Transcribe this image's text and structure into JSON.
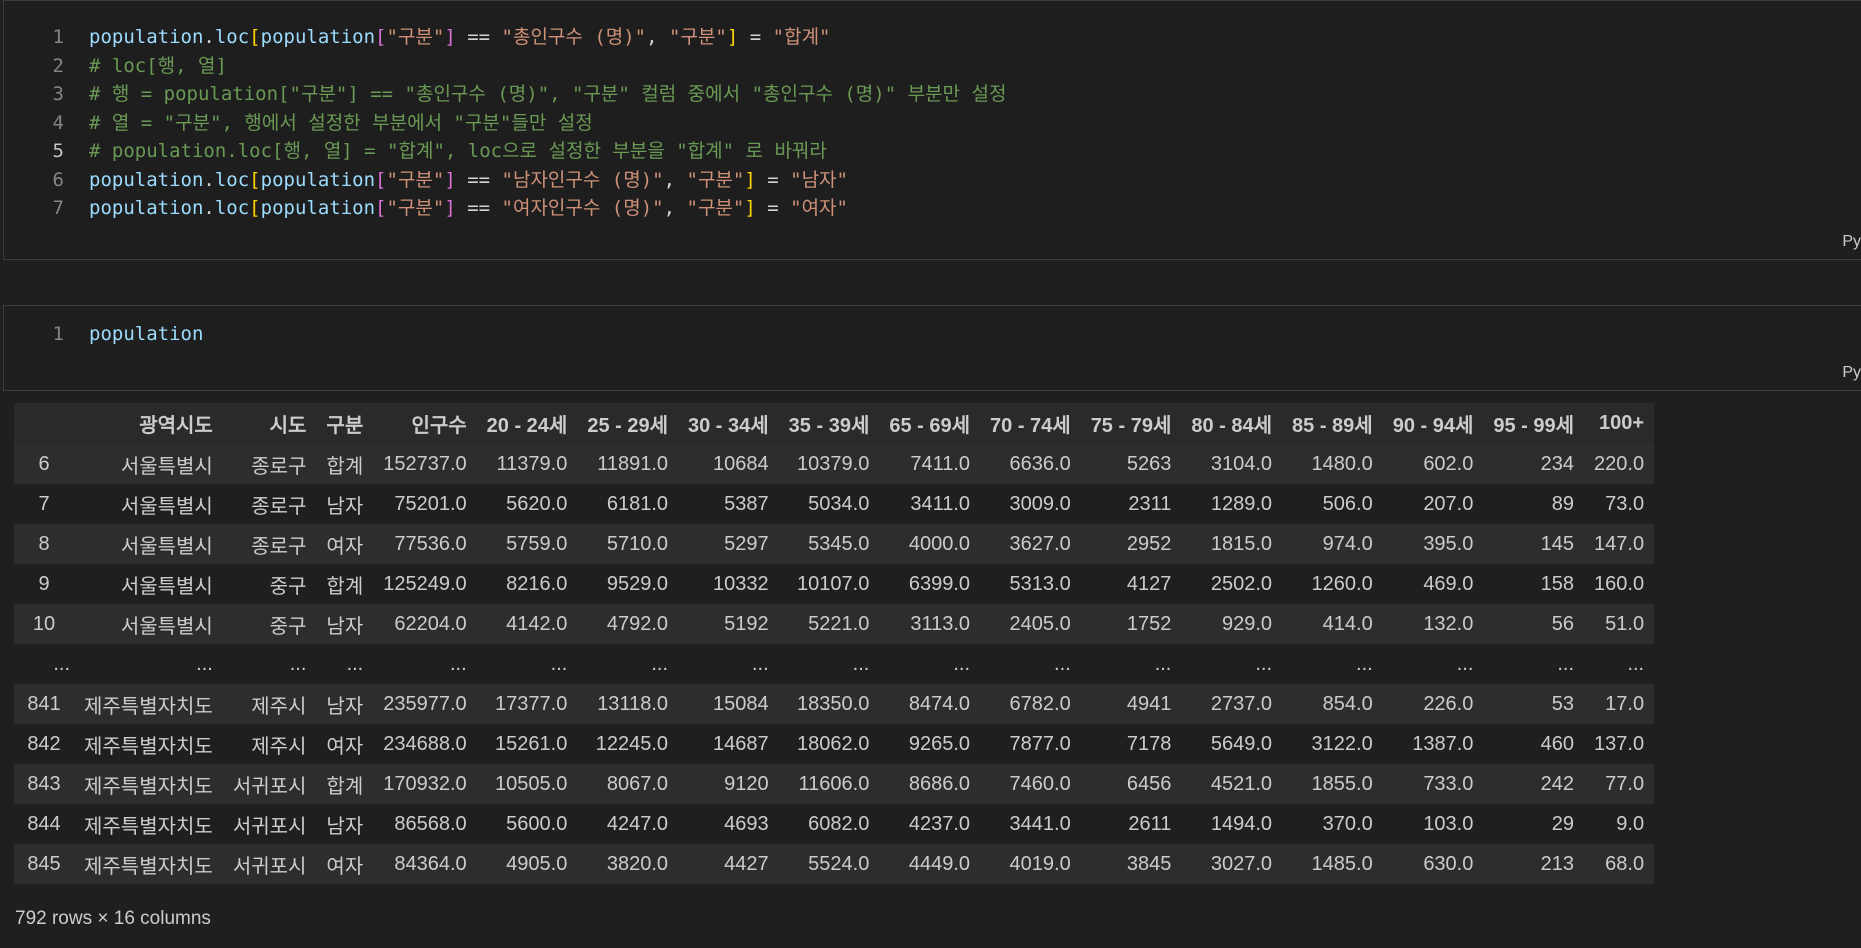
{
  "cell1": {
    "language": "Py",
    "lines": [
      {
        "n": "1",
        "parts": [
          [
            "var",
            "population"
          ],
          [
            "op",
            "."
          ],
          [
            "var",
            "loc"
          ],
          [
            "b1",
            "["
          ],
          [
            "var",
            "population"
          ],
          [
            "b2",
            "["
          ],
          [
            "str",
            "\"구분\""
          ],
          [
            "b2",
            "]"
          ],
          [
            "op",
            " == "
          ],
          [
            "str",
            "\"총인구수 (명)\""
          ],
          [
            "op",
            ", "
          ],
          [
            "str",
            "\"구분\""
          ],
          [
            "b1",
            "]"
          ],
          [
            "op",
            " = "
          ],
          [
            "str",
            "\"합계\""
          ]
        ]
      },
      {
        "n": "2",
        "parts": [
          [
            "cmt",
            "# loc[행, 열]"
          ]
        ]
      },
      {
        "n": "3",
        "parts": [
          [
            "cmt",
            "# 행 = population[\"구분\"] == \"총인구수 (명)\", \"구분\" 컬럼 중에서 \"총인구수 (명)\" 부분만 설정"
          ]
        ]
      },
      {
        "n": "4",
        "parts": [
          [
            "cmt",
            "# 열 = \"구분\", 행에서 설정한 부분에서 \"구분\"들만 설정"
          ]
        ]
      },
      {
        "n": "5",
        "active": true,
        "parts": [
          [
            "cmt",
            "# population.loc[행, 열] = \"합계\", loc으로 설정한 부분을 \"합계\" 로 바꿔라"
          ]
        ]
      },
      {
        "n": "6",
        "parts": [
          [
            "var",
            "population"
          ],
          [
            "op",
            "."
          ],
          [
            "var",
            "loc"
          ],
          [
            "b1",
            "["
          ],
          [
            "var",
            "population"
          ],
          [
            "b2",
            "["
          ],
          [
            "str",
            "\"구분\""
          ],
          [
            "b2",
            "]"
          ],
          [
            "op",
            " == "
          ],
          [
            "str",
            "\"남자인구수 (명)\""
          ],
          [
            "op",
            ", "
          ],
          [
            "str",
            "\"구분\""
          ],
          [
            "b1",
            "]"
          ],
          [
            "op",
            " = "
          ],
          [
            "str",
            "\"남자\""
          ]
        ]
      },
      {
        "n": "7",
        "parts": [
          [
            "var",
            "population"
          ],
          [
            "op",
            "."
          ],
          [
            "var",
            "loc"
          ],
          [
            "b1",
            "["
          ],
          [
            "var",
            "population"
          ],
          [
            "b2",
            "["
          ],
          [
            "str",
            "\"구분\""
          ],
          [
            "b2",
            "]"
          ],
          [
            "op",
            " == "
          ],
          [
            "str",
            "\"여자인구수 (명)\""
          ],
          [
            "op",
            ", "
          ],
          [
            "str",
            "\"구분\""
          ],
          [
            "b1",
            "]"
          ],
          [
            "op",
            " = "
          ],
          [
            "str",
            "\"여자\""
          ]
        ]
      }
    ]
  },
  "cell2": {
    "language": "Py",
    "lines": [
      {
        "n": "1",
        "parts": [
          [
            "var",
            "population"
          ]
        ]
      }
    ]
  },
  "output": {
    "columns": [
      "",
      "광역시도",
      "시도",
      "구분",
      "인구수",
      "20 - 24세",
      "25 - 29세",
      "30 - 34세",
      "35 - 39세",
      "65 - 69세",
      "70 - 74세",
      "75 - 79세",
      "80 - 84세",
      "85 - 89세",
      "90 - 94세",
      "95 - 99세",
      "100+"
    ],
    "rows": [
      [
        "6",
        "서울특별시",
        "종로구",
        "합계",
        "152737.0",
        "11379.0",
        "11891.0",
        "10684",
        "10379.0",
        "7411.0",
        "6636.0",
        "5263",
        "3104.0",
        "1480.0",
        "602.0",
        "234",
        "220.0"
      ],
      [
        "7",
        "서울특별시",
        "종로구",
        "남자",
        "75201.0",
        "5620.0",
        "6181.0",
        "5387",
        "5034.0",
        "3411.0",
        "3009.0",
        "2311",
        "1289.0",
        "506.0",
        "207.0",
        "89",
        "73.0"
      ],
      [
        "8",
        "서울특별시",
        "종로구",
        "여자",
        "77536.0",
        "5759.0",
        "5710.0",
        "5297",
        "5345.0",
        "4000.0",
        "3627.0",
        "2952",
        "1815.0",
        "974.0",
        "395.0",
        "145",
        "147.0"
      ],
      [
        "9",
        "서울특별시",
        "중구",
        "합계",
        "125249.0",
        "8216.0",
        "9529.0",
        "10332",
        "10107.0",
        "6399.0",
        "5313.0",
        "4127",
        "2502.0",
        "1260.0",
        "469.0",
        "158",
        "160.0"
      ],
      [
        "10",
        "서울특별시",
        "중구",
        "남자",
        "62204.0",
        "4142.0",
        "4792.0",
        "5192",
        "5221.0",
        "3113.0",
        "2405.0",
        "1752",
        "929.0",
        "414.0",
        "132.0",
        "56",
        "51.0"
      ],
      [
        "...",
        "...",
        "...",
        "...",
        "...",
        "...",
        "...",
        "...",
        "...",
        "...",
        "...",
        "...",
        "...",
        "...",
        "...",
        "...",
        "..."
      ],
      [
        "841",
        "제주특별자치도",
        "제주시",
        "남자",
        "235977.0",
        "17377.0",
        "13118.0",
        "15084",
        "18350.0",
        "8474.0",
        "6782.0",
        "4941",
        "2737.0",
        "854.0",
        "226.0",
        "53",
        "17.0"
      ],
      [
        "842",
        "제주특별자치도",
        "제주시",
        "여자",
        "234688.0",
        "15261.0",
        "12245.0",
        "14687",
        "18062.0",
        "9265.0",
        "7877.0",
        "7178",
        "5649.0",
        "3122.0",
        "1387.0",
        "460",
        "137.0"
      ],
      [
        "843",
        "제주특별자치도",
        "서귀포시",
        "합계",
        "170932.0",
        "10505.0",
        "8067.0",
        "9120",
        "11606.0",
        "8686.0",
        "7460.0",
        "6456",
        "4521.0",
        "1855.0",
        "733.0",
        "242",
        "77.0"
      ],
      [
        "844",
        "제주특별자치도",
        "서귀포시",
        "남자",
        "86568.0",
        "5600.0",
        "4247.0",
        "4693",
        "6082.0",
        "4237.0",
        "3441.0",
        "2611",
        "1494.0",
        "370.0",
        "103.0",
        "29",
        "9.0"
      ],
      [
        "845",
        "제주특별자치도",
        "서귀포시",
        "여자",
        "84364.0",
        "4905.0",
        "3820.0",
        "4427",
        "5524.0",
        "4449.0",
        "4019.0",
        "3845",
        "3027.0",
        "1485.0",
        "630.0",
        "213",
        "68.0"
      ]
    ],
    "footer": "792 rows × 16 columns"
  },
  "colors": {
    "background": "#1f1f1f",
    "variable": "#9cdcfe",
    "string": "#ce9178",
    "comment": "#6a9955",
    "bracket_outer": "#ffd700",
    "bracket_inner": "#da70d6"
  }
}
